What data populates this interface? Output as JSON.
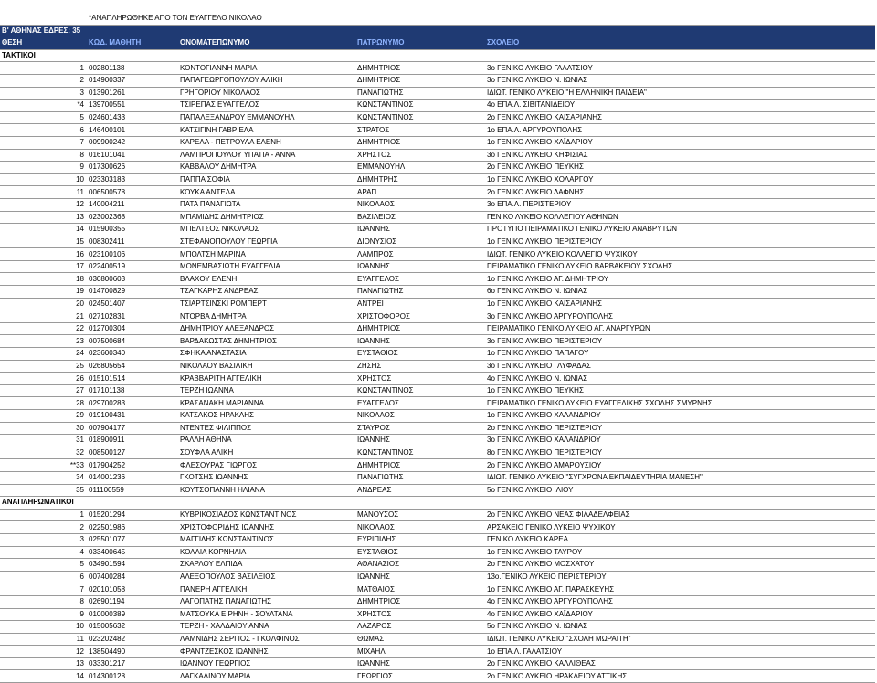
{
  "note": "*ΑΝΑΠΛΗΡΩΘΗΚΕ ΑΠΟ ΤΟΝ ΕΥΑΓΓΕΛΟ ΝΙΚΟΛΑΟ",
  "title": "Β' ΑΘΗΝΑΣ   ΕΔΡΕΣ: 35",
  "headers": {
    "position": "ΘΕΣΗ",
    "code": "ΚΩΔ. ΜΑΘΗΤΗ",
    "name": "ΟΝΟΜΑΤΕΠΩΝΥΜΟ",
    "father": "ΠΑΤΡΩΝΥΜΟ",
    "school": "ΣΧΟΛΕΙΟ"
  },
  "sections": [
    {
      "label": "ΤΑΚΤΙΚΟΙ",
      "rows": [
        [
          "1",
          "002801138",
          "ΚΟΝΤΟΓΙΑΝΝΗ ΜΑΡΙΑ",
          "ΔΗΜΗΤΡΙΟΣ",
          "3ο ΓΕΝΙΚΟ ΛΥΚΕΙΟ ΓΑΛΑΤΣΙΟΥ"
        ],
        [
          "2",
          "014900337",
          "ΠΑΠΑΓΕΩΡΓΟΠΟΥΛΟΥ ΑΛΙΚΗ",
          "ΔΗΜΗΤΡΙΟΣ",
          "3ο ΓΕΝΙΚΟ ΛΥΚΕΙΟ Ν. ΙΩΝΙΑΣ"
        ],
        [
          "3",
          "013901261",
          "ΓΡΗΓΟΡΙΟΥ ΝΙΚΟΛΑΟΣ",
          "ΠΑΝΑΓΙΩΤΗΣ",
          "ΙΔΙΩΤ. ΓΕΝΙΚΟ ΛΥΚΕΙΟ \"Η ΕΛΛΗΝΙΚΗ ΠΑΙΔΕΙΑ\""
        ],
        [
          "*4",
          "139700551",
          "ΤΣΙΡΕΠΑΣ ΕΥΑΓΓΕΛΟΣ",
          "ΚΩΝΣΤΑΝΤΙΝΟΣ",
          "4ο ΕΠΑ.Λ. ΣΙΒΙΤΑΝΙΔΕΙΟΥ"
        ],
        [
          "5",
          "024601433",
          "ΠΑΠΑΛΕΞΑΝΔΡΟΥ ΕΜΜΑΝΟΥΗΛ",
          "ΚΩΝΣΤΑΝΤΙΝΟΣ",
          "2ο ΓΕΝΙΚΟ ΛΥΚΕΙΟ ΚΑΙΣΑΡΙΑΝΗΣ"
        ],
        [
          "6",
          "146400101",
          "ΚΑΤΣΙΓΙΝΗ ΓΑΒΡΙΕΛΑ",
          "ΣΤΡΑΤΟΣ",
          "1ο ΕΠΑ.Λ. ΑΡΓΥΡΟΥΠΟΛΗΣ"
        ],
        [
          "7",
          "009900242",
          "ΚΑΡΕΛΑ - ΠΕΤΡΟΥΛΑ ΕΛΕΝΗ",
          "ΔΗΜΗΤΡΙΟΣ",
          "1ο ΓΕΝΙΚΟ ΛΥΚΕΙΟ ΧΑΪΔΑΡΙΟΥ"
        ],
        [
          "8",
          "016101041",
          "ΛΑΜΠΡΟΠΟΥΛΟΥ ΥΠΑΤΙΑ - ΑΝΝΑ",
          "ΧΡΗΣΤΟΣ",
          "3ο ΓΕΝΙΚΟ ΛΥΚΕΙΟ ΚΗΦΙΣΙΑΣ"
        ],
        [
          "9",
          "017300626",
          "ΚΑΒΒΑΛΟΥ ΔΗΜΗΤΡΑ",
          "ΕΜΜΑΝΟΥΗΛ",
          "2ο ΓΕΝΙΚΟ ΛΥΚΕΙΟ ΠΕΥΚΗΣ"
        ],
        [
          "10",
          "023303183",
          "ΠΑΠΠΑ ΣΟΦΙΑ",
          "ΔΗΜΗΤΡΗΣ",
          "1ο ΓΕΝΙΚΟ ΛΥΚΕΙΟ ΧΟΛΑΡΓΟΥ"
        ],
        [
          "11",
          "006500578",
          "ΚΟΥΚΑ ΑΝΤΕΛΑ",
          "ΑΡΑΠ",
          "2ο ΓΕΝΙΚΟ ΛΥΚΕΙΟ ΔΑΦΝΗΣ"
        ],
        [
          "12",
          "140004211",
          "ΠΑΤΑ ΠΑΝΑΓΙΩΤΑ",
          "ΝΙΚΟΛΑΟΣ",
          "3ο ΕΠΑ.Λ. ΠΕΡΙΣΤΕΡΙΟΥ"
        ],
        [
          "13",
          "023002368",
          "ΜΠΑΜΙΔΗΣ ΔΗΜΗΤΡΙΟΣ",
          "ΒΑΣΙΛΕΙΟΣ",
          "ΓΕΝΙΚΟ ΛΥΚΕΙΟ ΚΟΛΛΕΓΙΟΥ ΑΘΗΝΩΝ"
        ],
        [
          "14",
          "015900355",
          "ΜΠΕΛΤΣΟΣ ΝΙΚΟΛΑΟΣ",
          "ΙΩΑΝΝΗΣ",
          "ΠΡΟΤΥΠΟ ΠΕΙΡΑΜΑΤΙΚΟ ΓΕΝΙΚΟ ΛΥΚΕΙΟ ΑΝΑΒΡΥΤΩΝ"
        ],
        [
          "15",
          "008302411",
          "ΣΤΕΦΑΝΟΠΟΥΛΟΥ ΓΕΩΡΓΙΑ",
          "ΔΙΟΝΥΣΙΟΣ",
          "1ο ΓΕΝΙΚΟ ΛΥΚΕΙΟ ΠΕΡΙΣΤΕΡΙΟΥ"
        ],
        [
          "16",
          "023100106",
          "ΜΠΟΛΤΣΗ ΜΑΡΙΝΑ",
          "ΛΑΜΠΡΟΣ",
          "ΙΔΙΩΤ. ΓΕΝΙΚΟ ΛΥΚΕΙΟ ΚΟΛΛΕΓΙΟ ΨΥΧΙΚΟΥ"
        ],
        [
          "17",
          "022400519",
          "ΜΟΝΕΜΒΑΣΙΩΤΗ ΕΥΑΓΓΕΛΙΑ",
          "ΙΩΑΝΝΗΣ",
          "ΠΕΙΡΑΜΑΤΙΚΟ ΓΕΝΙΚΟ ΛΥΚΕΙΟ ΒΑΡΒΑΚΕΙΟΥ ΣΧΟΛΗΣ"
        ],
        [
          "18",
          "030800603",
          "ΒΛΑΧΟΥ ΕΛΕΝΗ",
          "ΕΥΑΓΓΕΛΟΣ",
          "1ο ΓΕΝΙΚΟ ΛΥΚΕΙΟ ΑΓ. ΔΗΜΗΤΡΙΟΥ"
        ],
        [
          "19",
          "014700829",
          "ΤΣΑΓΚΑΡΗΣ ΑΝΔΡΕΑΣ",
          "ΠΑΝΑΓΙΩΤΗΣ",
          "6ο ΓΕΝΙΚΟ ΛΥΚΕΙΟ Ν. ΙΩΝΙΑΣ"
        ],
        [
          "20",
          "024501407",
          "ΤΣΙΑΡΤΣΙΝΣΚΙ ΡΟΜΠΕΡΤ",
          "ΑΝΤΡΕΙ",
          "1ο ΓΕΝΙΚΟ ΛΥΚΕΙΟ ΚΑΙΣΑΡΙΑΝΗΣ"
        ],
        [
          "21",
          "027102831",
          "ΝΤΟΡΒΑ ΔΗΜΗΤΡΑ",
          "ΧΡΙΣΤΟΦΟΡΟΣ",
          "3ο ΓΕΝΙΚΟ ΛΥΚΕΙΟ ΑΡΓΥΡΟΥΠΟΛΗΣ"
        ],
        [
          "22",
          "012700304",
          "ΔΗΜΗΤΡΙΟΥ ΑΛΕΞΑΝΔΡΟΣ",
          "ΔΗΜΗΤΡΙΟΣ",
          "ΠΕΙΡΑΜΑΤΙΚΟ ΓΕΝΙΚΟ ΛΥΚΕΙΟ ΑΓ. ΑΝΑΡΓΥΡΩΝ"
        ],
        [
          "23",
          "007500684",
          "ΒΑΡΔΑΚΩΣΤΑΣ ΔΗΜΗΤΡΙΟΣ",
          "ΙΩΑΝΝΗΣ",
          "3ο ΓΕΝΙΚΟ ΛΥΚΕΙΟ ΠΕΡΙΣΤΕΡΙΟΥ"
        ],
        [
          "24",
          "023600340",
          "ΣΦΗΚΑ ΑΝΑΣΤΑΣΙΑ",
          "ΕΥΣΤΑΘΙΟΣ",
          "1ο ΓΕΝΙΚΟ ΛΥΚΕΙΟ ΠΑΠΑΓΟΥ"
        ],
        [
          "25",
          "026805654",
          "ΝΙΚΟΛΑΟΥ ΒΑΣΙΛΙΚΗ",
          "ΖΗΣΗΣ",
          "3ο ΓΕΝΙΚΟ ΛΥΚΕΙΟ ΓΛΥΦΑΔΑΣ"
        ],
        [
          "26",
          "015101514",
          "ΚΡΑΒΒΑΡΙΤΗ ΑΓΓΕΛΙΚΗ",
          "ΧΡΗΣΤΟΣ",
          "4ο ΓΕΝΙΚΟ ΛΥΚΕΙΟ Ν. ΙΩΝΙΑΣ"
        ],
        [
          "27",
          "017101138",
          "ΤΕΡΖΗ ΙΩΑΝΝΑ",
          "ΚΩΝΣΤΑΝΤΙΝΟΣ",
          "1ο ΓΕΝΙΚΟ ΛΥΚΕΙΟ ΠΕΥΚΗΣ"
        ],
        [
          "28",
          "029700283",
          "ΚΡΑΣΑΝΑΚΗ ΜΑΡΙΑΝΝΑ",
          "ΕΥΑΓΓΕΛΟΣ",
          "ΠΕΙΡΑΜΑΤΙΚΟ ΓΕΝΙΚΟ ΛΥΚΕΙΟ ΕΥΑΓΓΕΛΙΚΗΣ ΣΧΟΛΗΣ ΣΜΥΡΝΗΣ"
        ],
        [
          "29",
          "019100431",
          "ΚΑΤΣΑΚΟΣ ΗΡΑΚΛΗΣ",
          "ΝΙΚΟΛΑΟΣ",
          "1ο ΓΕΝΙΚΟ ΛΥΚΕΙΟ ΧΑΛΑΝΔΡΙΟΥ"
        ],
        [
          "30",
          "007904177",
          "ΝΤΕΝΤΕΣ ΦΙΛΙΠΠΟΣ",
          "ΣΤΑΥΡΟΣ",
          "2ο ΓΕΝΙΚΟ ΛΥΚΕΙΟ ΠΕΡΙΣΤΕΡΙΟΥ"
        ],
        [
          "31",
          "018900911",
          "ΡΑΛΛΗ ΑΘΗΝΑ",
          "ΙΩΑΝΝΗΣ",
          "3ο ΓΕΝΙΚΟ ΛΥΚΕΙΟ ΧΑΛΑΝΔΡΙΟΥ"
        ],
        [
          "32",
          "008500127",
          "ΣΟΥΦΛΑ ΑΛΙΚΗ",
          "ΚΩΝΣΤΑΝΤΙΝΟΣ",
          "8ο ΓΕΝΙΚΟ ΛΥΚΕΙΟ ΠΕΡΙΣΤΕΡΙΟΥ"
        ],
        [
          "**33",
          "017904252",
          "ΦΛΕΣΟΥΡΑΣ ΓΙΩΡΓΟΣ",
          "ΔΗΜΗΤΡΙΟΣ",
          "2ο ΓΕΝΙΚΟ ΛΥΚΕΙΟ ΑΜΑΡΟΥΣΙΟΥ"
        ],
        [
          "34",
          "014001236",
          "ΓΚΟΤΣΗΣ ΙΩΑΝΝΗΣ",
          "ΠΑΝΑΓΙΩΤΗΣ",
          "ΙΔΙΩΤ. ΓΕΝΙΚΟ ΛΥΚΕΙΟ \"ΣΥΓΧΡΟΝΑ ΕΚΠΑΙΔΕΥΤΗΡΙΑ ΜΑΝΕΣΗ\""
        ],
        [
          "35",
          "011100559",
          "ΚΟΥΤΣΟΠΑΝΝΗ ΗΛΙΑΝΑ",
          "ΑΝΔΡΕΑΣ",
          "5ο ΓΕΝΙΚΟ ΛΥΚΕΙΟ ΙΛΙΟΥ"
        ]
      ]
    },
    {
      "label": "ΑΝΑΠΛΗΡΩΜΑΤΙΚΟΙ",
      "rows": [
        [
          "1",
          "015201294",
          "ΚΥΒΡΙΚΟΣΙΑΔΟΣ ΚΩΝΣΤΑΝΤΙΝΟΣ",
          "ΜΑΝΟΥΣΟΣ",
          "2ο ΓΕΝΙΚΟ ΛΥΚΕΙΟ ΝΕΑΣ ΦΙΛΑΔΕΛΦΕΙΑΣ"
        ],
        [
          "2",
          "022501986",
          "ΧΡΙΣΤΟΦΟΡΙΔΗΣ ΙΩΑΝΝΗΣ",
          "ΝΙΚΟΛΑΟΣ",
          "ΑΡΣΑΚΕΙΟ ΓΕΝΙΚΟ ΛΥΚΕΙΟ ΨΥΧΙΚΟΥ"
        ],
        [
          "3",
          "025501077",
          "ΜΑΓΓΙΔΗΣ ΚΩΝΣΤΑΝΤΙΝΟΣ",
          "ΕΥΡΙΠΙΔΗΣ",
          "ΓΕΝΙΚΟ ΛΥΚΕΙΟ ΚΑΡΕΑ"
        ],
        [
          "4",
          "033400645",
          "ΚΟΛΛΙΑ ΚΟΡΝΗΛΙΑ",
          "ΕΥΣΤΑΘΙΟΣ",
          "1ο ΓΕΝΙΚΟ ΛΥΚΕΙΟ ΤΑΥΡΟΥ"
        ],
        [
          "5",
          "034901594",
          "ΣΚΑΡΛΟΥ ΕΛΠΙΔΑ",
          "ΑΘΑΝΑΣΙΟΣ",
          "2ο ΓΕΝΙΚΟ ΛΥΚΕΙΟ ΜΟΣΧΑΤΟΥ"
        ],
        [
          "6",
          "007400284",
          "ΑΛΕΞΟΠΟΥΛΟΣ ΒΑΣΙΛΕΙΟΣ",
          "ΙΩΑΝΝΗΣ",
          "13ο.ΓΕΝΙΚΟ ΛΥΚΕΙΟ ΠΕΡΙΣΤΕΡΙΟΥ"
        ],
        [
          "7",
          "020101058",
          "ΠΑΝΕΡΗ ΑΓΓΕΛΙΚΗ",
          "ΜΑΤΘΑΙΟΣ",
          "1ο ΓΕΝΙΚΟ ΛΥΚΕΙΟ ΑΓ. ΠΑΡΑΣΚΕΥΗΣ"
        ],
        [
          "8",
          "026901194",
          "ΛΑΓΟΠΑΤΗΣ ΠΑΝΑΓΙΩΤΗΣ",
          "ΔΗΜΗΤΡΙΟΣ",
          "4ο ΓΕΝΙΚΟ ΛΥΚΕΙΟ ΑΡΓΥΡΟΥΠΟΛΗΣ"
        ],
        [
          "9",
          "010000389",
          "ΜΑΤΣΟΥΚΑ ΕΙΡΗΝΗ - ΣΟΥΛΤΑΝΑ",
          "ΧΡΗΣΤΟΣ",
          "4ο ΓΕΝΙΚΟ ΛΥΚΕΙΟ ΧΑΪΔΑΡΙΟΥ"
        ],
        [
          "10",
          "015005632",
          "ΤΕΡΖΗ - ΧΑΛΔΑΙΟΥ ΑΝΝΑ",
          "ΛΑΖΑΡΟΣ",
          "5ο ΓΕΝΙΚΟ ΛΥΚΕΙΟ Ν. ΙΩΝΙΑΣ"
        ],
        [
          "11",
          "023202482",
          "ΛΑΜΝΙΔΗΣ ΣΕΡΓΙΟΣ - ΓΚΟΛΦΙΝΟΣ",
          "ΘΩΜΑΣ",
          "ΙΔΙΩΤ. ΓΕΝΙΚΟ ΛΥΚΕΙΟ \"ΣΧΟΛΗ ΜΩΡΑΙΤΗ\""
        ],
        [
          "12",
          "138504490",
          "ΦΡΑΝΤΖΕΣΚΟΣ ΙΩΑΝΝΗΣ",
          "ΜΙΧΑΗΛ",
          "1ο ΕΠΑ.Λ. ΓΑΛΑΤΣΙΟΥ"
        ],
        [
          "13",
          "033301217",
          "ΙΩΑΝΝΟΥ ΓΕΩΡΓΙΟΣ",
          "ΙΩΑΝΝΗΣ",
          "2ο ΓΕΝΙΚΟ ΛΥΚΕΙΟ ΚΑΛΛΙΘΕΑΣ"
        ],
        [
          "14",
          "014300128",
          "ΛΑΓΚΑΔΙΝΟΥ ΜΑΡΙΑ",
          "ΓΕΩΡΓΙΟΣ",
          "2ο ΓΕΝΙΚΟ ΛΥΚΕΙΟ ΗΡΑΚΛΕΙΟΥ ΑΤΤΙΚΗΣ"
        ]
      ]
    }
  ]
}
